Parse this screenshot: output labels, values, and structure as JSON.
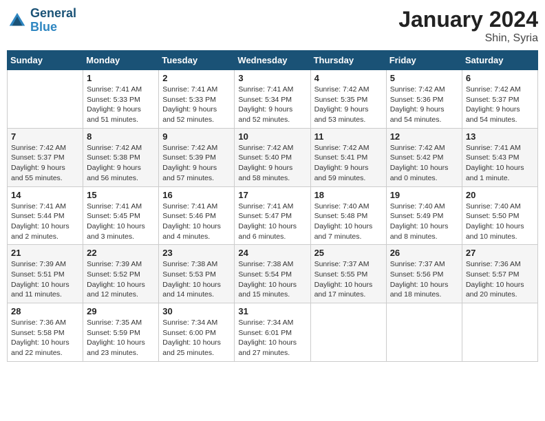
{
  "header": {
    "logo": {
      "line1": "General",
      "line2": "Blue"
    },
    "title": "January 2024",
    "location": "Shin, Syria"
  },
  "days_of_week": [
    "Sunday",
    "Monday",
    "Tuesday",
    "Wednesday",
    "Thursday",
    "Friday",
    "Saturday"
  ],
  "weeks": [
    [
      {
        "num": "",
        "info": ""
      },
      {
        "num": "1",
        "info": "Sunrise: 7:41 AM\nSunset: 5:33 PM\nDaylight: 9 hours\nand 51 minutes."
      },
      {
        "num": "2",
        "info": "Sunrise: 7:41 AM\nSunset: 5:33 PM\nDaylight: 9 hours\nand 52 minutes."
      },
      {
        "num": "3",
        "info": "Sunrise: 7:41 AM\nSunset: 5:34 PM\nDaylight: 9 hours\nand 52 minutes."
      },
      {
        "num": "4",
        "info": "Sunrise: 7:42 AM\nSunset: 5:35 PM\nDaylight: 9 hours\nand 53 minutes."
      },
      {
        "num": "5",
        "info": "Sunrise: 7:42 AM\nSunset: 5:36 PM\nDaylight: 9 hours\nand 54 minutes."
      },
      {
        "num": "6",
        "info": "Sunrise: 7:42 AM\nSunset: 5:37 PM\nDaylight: 9 hours\nand 54 minutes."
      }
    ],
    [
      {
        "num": "7",
        "info": "Sunrise: 7:42 AM\nSunset: 5:37 PM\nDaylight: 9 hours\nand 55 minutes."
      },
      {
        "num": "8",
        "info": "Sunrise: 7:42 AM\nSunset: 5:38 PM\nDaylight: 9 hours\nand 56 minutes."
      },
      {
        "num": "9",
        "info": "Sunrise: 7:42 AM\nSunset: 5:39 PM\nDaylight: 9 hours\nand 57 minutes."
      },
      {
        "num": "10",
        "info": "Sunrise: 7:42 AM\nSunset: 5:40 PM\nDaylight: 9 hours\nand 58 minutes."
      },
      {
        "num": "11",
        "info": "Sunrise: 7:42 AM\nSunset: 5:41 PM\nDaylight: 9 hours\nand 59 minutes."
      },
      {
        "num": "12",
        "info": "Sunrise: 7:42 AM\nSunset: 5:42 PM\nDaylight: 10 hours\nand 0 minutes."
      },
      {
        "num": "13",
        "info": "Sunrise: 7:41 AM\nSunset: 5:43 PM\nDaylight: 10 hours\nand 1 minute."
      }
    ],
    [
      {
        "num": "14",
        "info": "Sunrise: 7:41 AM\nSunset: 5:44 PM\nDaylight: 10 hours\nand 2 minutes."
      },
      {
        "num": "15",
        "info": "Sunrise: 7:41 AM\nSunset: 5:45 PM\nDaylight: 10 hours\nand 3 minutes."
      },
      {
        "num": "16",
        "info": "Sunrise: 7:41 AM\nSunset: 5:46 PM\nDaylight: 10 hours\nand 4 minutes."
      },
      {
        "num": "17",
        "info": "Sunrise: 7:41 AM\nSunset: 5:47 PM\nDaylight: 10 hours\nand 6 minutes."
      },
      {
        "num": "18",
        "info": "Sunrise: 7:40 AM\nSunset: 5:48 PM\nDaylight: 10 hours\nand 7 minutes."
      },
      {
        "num": "19",
        "info": "Sunrise: 7:40 AM\nSunset: 5:49 PM\nDaylight: 10 hours\nand 8 minutes."
      },
      {
        "num": "20",
        "info": "Sunrise: 7:40 AM\nSunset: 5:50 PM\nDaylight: 10 hours\nand 10 minutes."
      }
    ],
    [
      {
        "num": "21",
        "info": "Sunrise: 7:39 AM\nSunset: 5:51 PM\nDaylight: 10 hours\nand 11 minutes."
      },
      {
        "num": "22",
        "info": "Sunrise: 7:39 AM\nSunset: 5:52 PM\nDaylight: 10 hours\nand 12 minutes."
      },
      {
        "num": "23",
        "info": "Sunrise: 7:38 AM\nSunset: 5:53 PM\nDaylight: 10 hours\nand 14 minutes."
      },
      {
        "num": "24",
        "info": "Sunrise: 7:38 AM\nSunset: 5:54 PM\nDaylight: 10 hours\nand 15 minutes."
      },
      {
        "num": "25",
        "info": "Sunrise: 7:37 AM\nSunset: 5:55 PM\nDaylight: 10 hours\nand 17 minutes."
      },
      {
        "num": "26",
        "info": "Sunrise: 7:37 AM\nSunset: 5:56 PM\nDaylight: 10 hours\nand 18 minutes."
      },
      {
        "num": "27",
        "info": "Sunrise: 7:36 AM\nSunset: 5:57 PM\nDaylight: 10 hours\nand 20 minutes."
      }
    ],
    [
      {
        "num": "28",
        "info": "Sunrise: 7:36 AM\nSunset: 5:58 PM\nDaylight: 10 hours\nand 22 minutes."
      },
      {
        "num": "29",
        "info": "Sunrise: 7:35 AM\nSunset: 5:59 PM\nDaylight: 10 hours\nand 23 minutes."
      },
      {
        "num": "30",
        "info": "Sunrise: 7:34 AM\nSunset: 6:00 PM\nDaylight: 10 hours\nand 25 minutes."
      },
      {
        "num": "31",
        "info": "Sunrise: 7:34 AM\nSunset: 6:01 PM\nDaylight: 10 hours\nand 27 minutes."
      },
      {
        "num": "",
        "info": ""
      },
      {
        "num": "",
        "info": ""
      },
      {
        "num": "",
        "info": ""
      }
    ]
  ]
}
